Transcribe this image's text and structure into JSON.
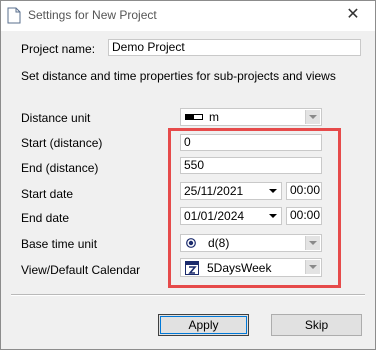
{
  "window": {
    "title": "Settings for New Project",
    "close_glyph": "✕"
  },
  "project": {
    "name_label": "Project name:",
    "name_value": "Demo Project"
  },
  "description": "Set distance and time properties for sub-projects and views",
  "fields": {
    "distance_unit": {
      "label": "Distance unit",
      "value": "m",
      "icon": "ruler-icon"
    },
    "start_distance": {
      "label": "Start (distance)",
      "value": "0"
    },
    "end_distance": {
      "label": "End (distance)",
      "value": "550"
    },
    "start_date": {
      "label": "Start date",
      "date": "25/11/2021",
      "time": "00:00"
    },
    "end_date": {
      "label": "End date",
      "date": "01/01/2024",
      "time": "00:00"
    },
    "base_time_unit": {
      "label": "Base time unit",
      "value": "d(8)",
      "icon": "clock-icon"
    },
    "calendar": {
      "label": "View/Default Calendar",
      "value": "5DaysWeek",
      "icon": "calendar-icon"
    }
  },
  "buttons": {
    "apply": "Apply",
    "skip": "Skip"
  },
  "colors": {
    "highlight": "#e64a4a",
    "focus": "#0078d7"
  }
}
